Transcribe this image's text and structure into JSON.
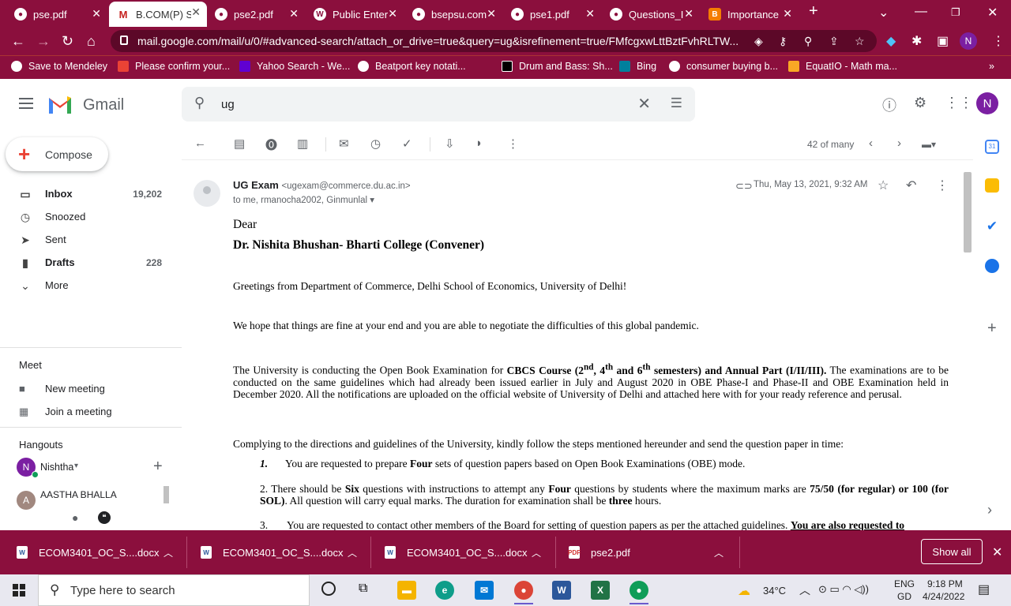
{
  "browser": {
    "tabs": [
      {
        "title": "pse.pdf",
        "icon": "chrome-icon"
      },
      {
        "title": "B.COM(P) S",
        "icon": "gmail-icon"
      },
      {
        "title": "pse2.pdf",
        "icon": "chrome-icon"
      },
      {
        "title": "Public Enter",
        "icon": "wordpress-icon"
      },
      {
        "title": "bsepsu.com",
        "icon": "chrome-icon"
      },
      {
        "title": "pse1.pdf",
        "icon": "chrome-icon"
      },
      {
        "title": "Questions_I",
        "icon": "chrome-icon"
      },
      {
        "title": "Importance",
        "icon": "blogger-icon"
      }
    ],
    "new_tab": "+",
    "url": "mail.google.com/mail/u/0/#advanced-search/attach_or_drive=true&query=ug&isrefinement=true/FMfcgxwLttBztFvhRLTW...",
    "profile_initial": "N",
    "bookmarks": [
      "Save to Mendeley",
      "Please confirm your...",
      "Yahoo Search - We...",
      "Beatport key notati...",
      "Drum and Bass: Sh...",
      "Bing",
      "consumer buying b...",
      "EquatIO - Math ma..."
    ],
    "bookmarks_more": "»"
  },
  "gmail": {
    "product_name": "Gmail",
    "search_value": "ug",
    "profile_initial": "N",
    "compose_label": "Compose",
    "nav": [
      {
        "label": "Inbox",
        "count": "19,202",
        "bold": true
      },
      {
        "label": "Snoozed",
        "count": "",
        "bold": false
      },
      {
        "label": "Sent",
        "count": "",
        "bold": false
      },
      {
        "label": "Drafts",
        "count": "228",
        "bold": true
      },
      {
        "label": "More",
        "count": "",
        "bold": false
      }
    ],
    "meet": {
      "heading": "Meet",
      "new_meeting": "New meeting",
      "join_meeting": "Join a meeting"
    },
    "hangouts": {
      "heading": "Hangouts",
      "user": "Nishtha",
      "user_initial": "N",
      "contact": "AASTHA BHALLA",
      "contact_initial": "A"
    },
    "pager": "42 of many"
  },
  "message": {
    "sender_name": "UG Exam",
    "sender_email": "<ugexam@commerce.du.ac.in>",
    "recipients": "to me, rmanocha2002, Ginmunlal",
    "date": "Thu, May 13, 2021, 9:32 AM",
    "salutation": "Dear",
    "addressee": "Dr. Nishita Bhushan- Bharti College (Convener)",
    "greeting": "Greetings from Department of Commerce, Delhi School of Economics, University of Delhi!",
    "hope": "We hope that things are fine at your end and you are able to negotiate the difficulties of this global pandemic.",
    "p3_a": "The University is conducting the Open Book Examination for ",
    "p3_b": "CBCS Course (2",
    "p3_sup1": "nd",
    "p3_c": ", 4",
    "p3_sup2": "th",
    "p3_d": " and 6",
    "p3_sup3": "th",
    "p3_e": " semesters) and Annual Part (I/II/III).",
    "p3_f": " The examinations are to be conducted on the same guidelines which had already been issued earlier in July and August 2020 in OBE Phase-I and Phase-II and OBE Examination held in December 2020. All the notifications are uploaded on the official website of University of Delhi and attached here with for your ready reference and perusal.",
    "p4": "Complying to the directions and guidelines of the University, kindly follow the steps mentioned hereunder and send the question paper in time:",
    "item1_num": "1.",
    "item1_a": "You are requested to prepare ",
    "item1_b": "Four",
    "item1_c": " sets of question papers based on Open Book Examinations (OBE) mode.",
    "item2_a": "2. There should be ",
    "item2_b": "Six",
    "item2_c": " questions with instructions to attempt any ",
    "item2_d": "Four",
    "item2_e": " questions by students where the maximum marks are ",
    "item2_f": "75/50 (for regular) or 100 (for SOL)",
    "item2_g": ". All question will carry equal marks. The duration for examination shall be ",
    "item2_h": "three",
    "item2_i": " hours.",
    "item3_num": "3.",
    "item3_a": "You are requested to contact other members of the Board for setting of question papers as per the attached guidelines. ",
    "item3_b": "You are also requested to"
  },
  "downloads": {
    "files": [
      "ECOM3401_OC_S....docx",
      "ECOM3401_OC_S....docx",
      "ECOM3401_OC_S....docx",
      "pse2.pdf"
    ],
    "show_all": "Show all"
  },
  "taskbar": {
    "search_placeholder": "Type here to search",
    "weather": "34°C",
    "lang_top": "ENG",
    "lang_bottom": "GD",
    "time": "9:18 PM",
    "date": "4/24/2022"
  }
}
